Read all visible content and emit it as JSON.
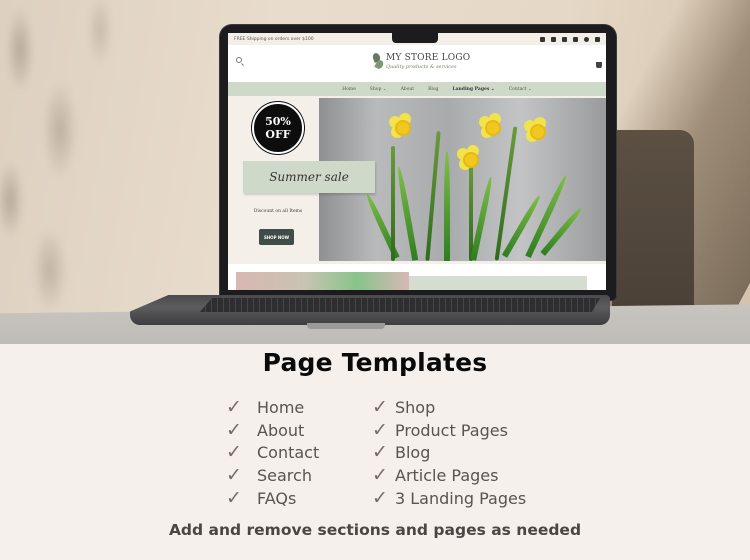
{
  "mockup": {
    "website": {
      "announcement_bar": {
        "text": "FREE Shipping on orders over $100",
        "social_icons": [
          "twitter-icon",
          "facebook-icon",
          "tiktok-icon",
          "instagram-icon",
          "pinterest-icon",
          "youtube-icon"
        ]
      },
      "header": {
        "search_icon": "search-icon",
        "logo_title": "MY STORE LOGO",
        "logo_tagline": "Quality products & services",
        "cart_icon": "cart-icon"
      },
      "nav": {
        "items": [
          {
            "label": "Home",
            "has_dropdown": false
          },
          {
            "label": "Shop ⌄",
            "has_dropdown": true
          },
          {
            "label": "About",
            "has_dropdown": false
          },
          {
            "label": "Blog",
            "has_dropdown": false
          },
          {
            "label": "Landing Pages ⌄",
            "has_dropdown": true
          },
          {
            "label": "Contact ⌄",
            "has_dropdown": true
          }
        ]
      },
      "hero": {
        "badge_line1": "50%",
        "badge_line2": "OFF",
        "sale_heading": "Summer sale",
        "subtext": "Discount on all Items",
        "cta_label": "SHOP NOW",
        "image_subject": "yellow daffodils"
      }
    }
  },
  "panel": {
    "title": "Page Templates",
    "check_glyph": "✓",
    "left_column": [
      "Home",
      "About",
      "Contact",
      "Search",
      "FAQs"
    ],
    "right_column": [
      "Shop",
      "Product Pages",
      "Blog",
      "Article Pages",
      "3 Landing Pages"
    ],
    "footer_note": "Add and remove sections and pages as needed"
  },
  "colors": {
    "panel_bg": "#f5f0ec",
    "nav_bg": "#cfd9c9",
    "check_color": "#7a6a64",
    "cta_bg": "#3f4c47"
  }
}
